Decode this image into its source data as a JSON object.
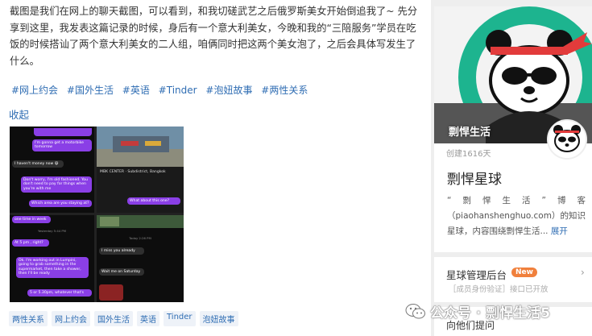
{
  "post": {
    "paragraph": "截图是我们在网上的聊天截图，可以看到，和我切磋武艺之后俄罗斯美女开始倒追我了~ 先分享到这里，我发表这篇记录的时候，身后有一个意大利美女，今晚和我的“三陪服务”学员在吃饭的时候搭讪了两个意大利美女的二人组，咱俩同时把这两个美女泡了，之后会具体写发生了什么。",
    "hashtags": [
      "#网上约会",
      "#国外生活",
      "#英语",
      "#Tinder",
      "#泡妞故事",
      "#两性关系"
    ],
    "collapse_label": "收起",
    "tags": [
      "两性关系",
      "网上约会",
      "国外生活",
      "英语",
      "Tinder",
      "泡妞故事"
    ]
  },
  "screenshots": {
    "c1": [
      "I'm gonna get a motorbike tomorrow",
      "I haven't money now 😃",
      "Don't worry, I'm old fashioned. You don't need to pay for things when you're with me",
      "Which area are you staying at?"
    ],
    "c2": [
      "MBK CENTER · Subdistrict, Bangkok",
      "What about this one?"
    ],
    "c3": [
      "one time in week",
      "Yesterday 5:44 PM",
      "At 5 pm , right?",
      "Ok. I'm working out in Lumpini, going to grab something in the supermarket, then take a shower, then I'll be ready",
      "5 or 5.30pm, whatever that's"
    ],
    "c4": [
      "Today 2:26 PM",
      "I miss you already",
      "Wait me on Saturday"
    ]
  },
  "sidebar": {
    "banner_title": "剽悍生活",
    "created": "创建1616天",
    "planet_name": "剽悍星球",
    "description": "“剽悍生活”博客（piaohanshenghuo.com）的知识星球，内容围绕剽悍生活...",
    "expand_label": "展开",
    "admin_title": "星球管理后台",
    "admin_badge": "New",
    "admin_sub": "［成员身份验证］接口已开放",
    "next_title": "向他们提问"
  },
  "watermark": "公众号 · 剽悍生活5",
  "colors": {
    "link": "#2f6db3",
    "accent": "#1db48f",
    "badge": "#f0803c"
  },
  "icons": [
    "panda-logo",
    "chevron-right-icon",
    "wechat-icon"
  ]
}
